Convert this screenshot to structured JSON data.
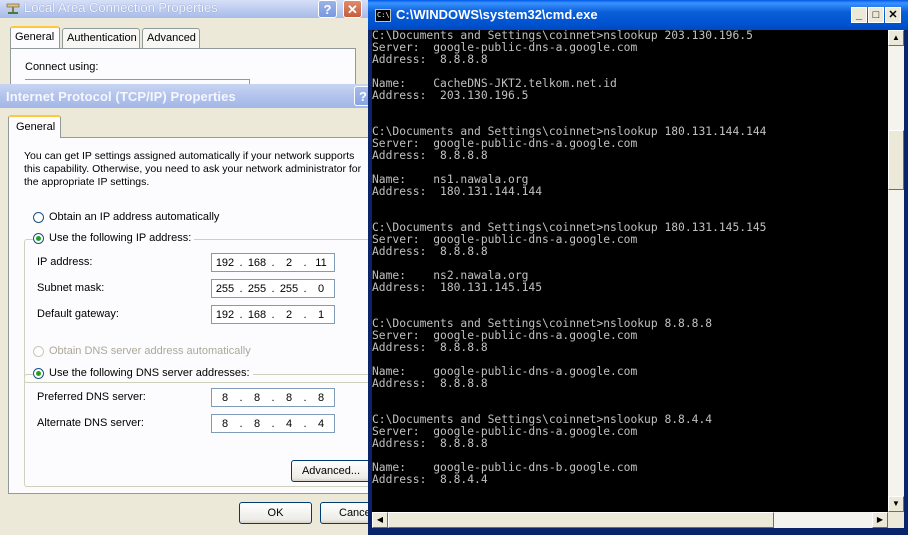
{
  "lan_window": {
    "title": "Local Area Connection Properties",
    "help_button": "?",
    "close_button": "✕",
    "tabs": [
      "General",
      "Authentication",
      "Advanced"
    ],
    "connect_using_label": "Connect using:"
  },
  "tcp_window": {
    "title": "Internet Protocol (TCP/IP) Properties",
    "help_button": "?",
    "tab": "General",
    "intro_text": "You can get IP settings assigned automatically if your network supports this capability. Otherwise, you need to ask your network administrator for the appropriate IP settings.",
    "radio_ip_auto": "Obtain an IP address automatically",
    "radio_ip_manual": "Use the following IP address:",
    "ip_fields": [
      {
        "label": "IP address:",
        "octets": [
          "192",
          "168",
          "2",
          "11"
        ]
      },
      {
        "label": "Subnet mask:",
        "octets": [
          "255",
          "255",
          "255",
          "0"
        ]
      },
      {
        "label": "Default gateway:",
        "octets": [
          "192",
          "168",
          "2",
          "1"
        ]
      }
    ],
    "radio_dns_auto": "Obtain DNS server address automatically",
    "radio_dns_manual": "Use the following DNS server addresses:",
    "dns_fields": [
      {
        "label": "Preferred DNS server:",
        "octets": [
          "8",
          "8",
          "8",
          "8"
        ]
      },
      {
        "label": "Alternate DNS server:",
        "octets": [
          "8",
          "8",
          "4",
          "4"
        ]
      }
    ],
    "advanced_button": "Advanced...",
    "ok_button": "OK",
    "cancel_button": "Cancel"
  },
  "cmd_window": {
    "title": "C:\\WINDOWS\\system32\\cmd.exe",
    "icon_text": "C:\\",
    "minimize": "_",
    "maximize": "□",
    "close": "✕",
    "lines": [
      "C:\\Documents and Settings\\coinnet>nslookup 203.130.196.5",
      "Server:  google-public-dns-a.google.com",
      "Address:  8.8.8.8",
      "",
      "Name:    CacheDNS-JKT2.telkom.net.id",
      "Address:  203.130.196.5",
      "",
      "",
      "C:\\Documents and Settings\\coinnet>nslookup 180.131.144.144",
      "Server:  google-public-dns-a.google.com",
      "Address:  8.8.8.8",
      "",
      "Name:    ns1.nawala.org",
      "Address:  180.131.144.144",
      "",
      "",
      "C:\\Documents and Settings\\coinnet>nslookup 180.131.145.145",
      "Server:  google-public-dns-a.google.com",
      "Address:  8.8.8.8",
      "",
      "Name:    ns2.nawala.org",
      "Address:  180.131.145.145",
      "",
      "",
      "C:\\Documents and Settings\\coinnet>nslookup 8.8.8.8",
      "Server:  google-public-dns-a.google.com",
      "Address:  8.8.8.8",
      "",
      "Name:    google-public-dns-a.google.com",
      "Address:  8.8.8.8",
      "",
      "",
      "C:\\Documents and Settings\\coinnet>nslookup 8.8.4.4",
      "Server:  google-public-dns-a.google.com",
      "Address:  8.8.8.8",
      "",
      "Name:    google-public-dns-b.google.com",
      "Address:  8.8.4.4"
    ]
  }
}
